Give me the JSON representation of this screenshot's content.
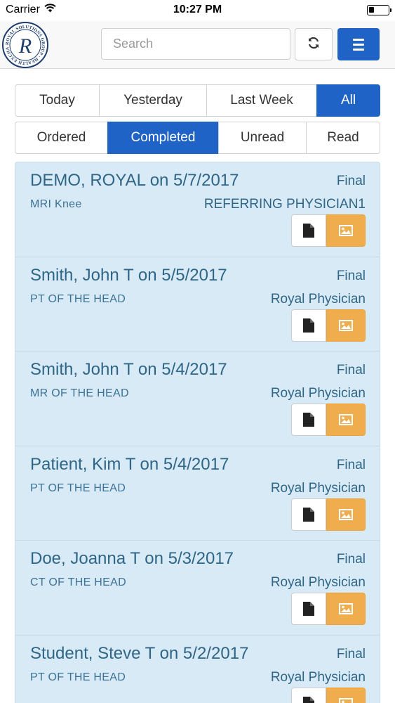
{
  "status_bar": {
    "carrier": "Carrier",
    "time": "10:27 PM"
  },
  "header": {
    "logo_text": "ROYAL SOLUTIONS GROUP HEALTH EXCHANGE",
    "logo_letter": "R",
    "search_placeholder": "Search",
    "search_value": ""
  },
  "date_filters": [
    {
      "label": "Today",
      "active": false
    },
    {
      "label": "Yesterday",
      "active": false
    },
    {
      "label": "Last Week",
      "active": false
    },
    {
      "label": "All",
      "active": true
    }
  ],
  "status_filters": [
    {
      "label": "Ordered",
      "active": false
    },
    {
      "label": "Completed",
      "active": true
    },
    {
      "label": "Unread",
      "active": false
    },
    {
      "label": "Read",
      "active": false
    }
  ],
  "results": [
    {
      "title": "DEMO, ROYAL on 5/7/2017",
      "status": "Final",
      "study": "MRI Knee",
      "physician": "REFERRING PHYSICIAN1"
    },
    {
      "title": "Smith, John T on 5/5/2017",
      "status": "Final",
      "study": "PT OF THE HEAD",
      "physician": "Royal Physician"
    },
    {
      "title": "Smith, John T on 5/4/2017",
      "status": "Final",
      "study": "MR OF THE HEAD",
      "physician": "Royal Physician"
    },
    {
      "title": "Patient, Kim T on 5/4/2017",
      "status": "Final",
      "study": "PT OF THE HEAD",
      "physician": "Royal Physician"
    },
    {
      "title": "Doe, Joanna T on 5/3/2017",
      "status": "Final",
      "study": "CT OF THE HEAD",
      "physician": "Royal Physician"
    },
    {
      "title": "Student, Steve T on 5/2/2017",
      "status": "Final",
      "study": "PT OF THE HEAD",
      "physician": "Royal Physician"
    }
  ],
  "icons": {
    "wifi": "wifi-icon",
    "battery": "battery-icon",
    "refresh": "refresh-icon",
    "menu": "hamburger-menu-icon",
    "document": "document-icon",
    "image": "image-icon"
  },
  "colors": {
    "primary": "#1f63c6",
    "image_button": "#f0ad4e",
    "list_background": "#d8eaf5",
    "text": "#2f6688"
  }
}
